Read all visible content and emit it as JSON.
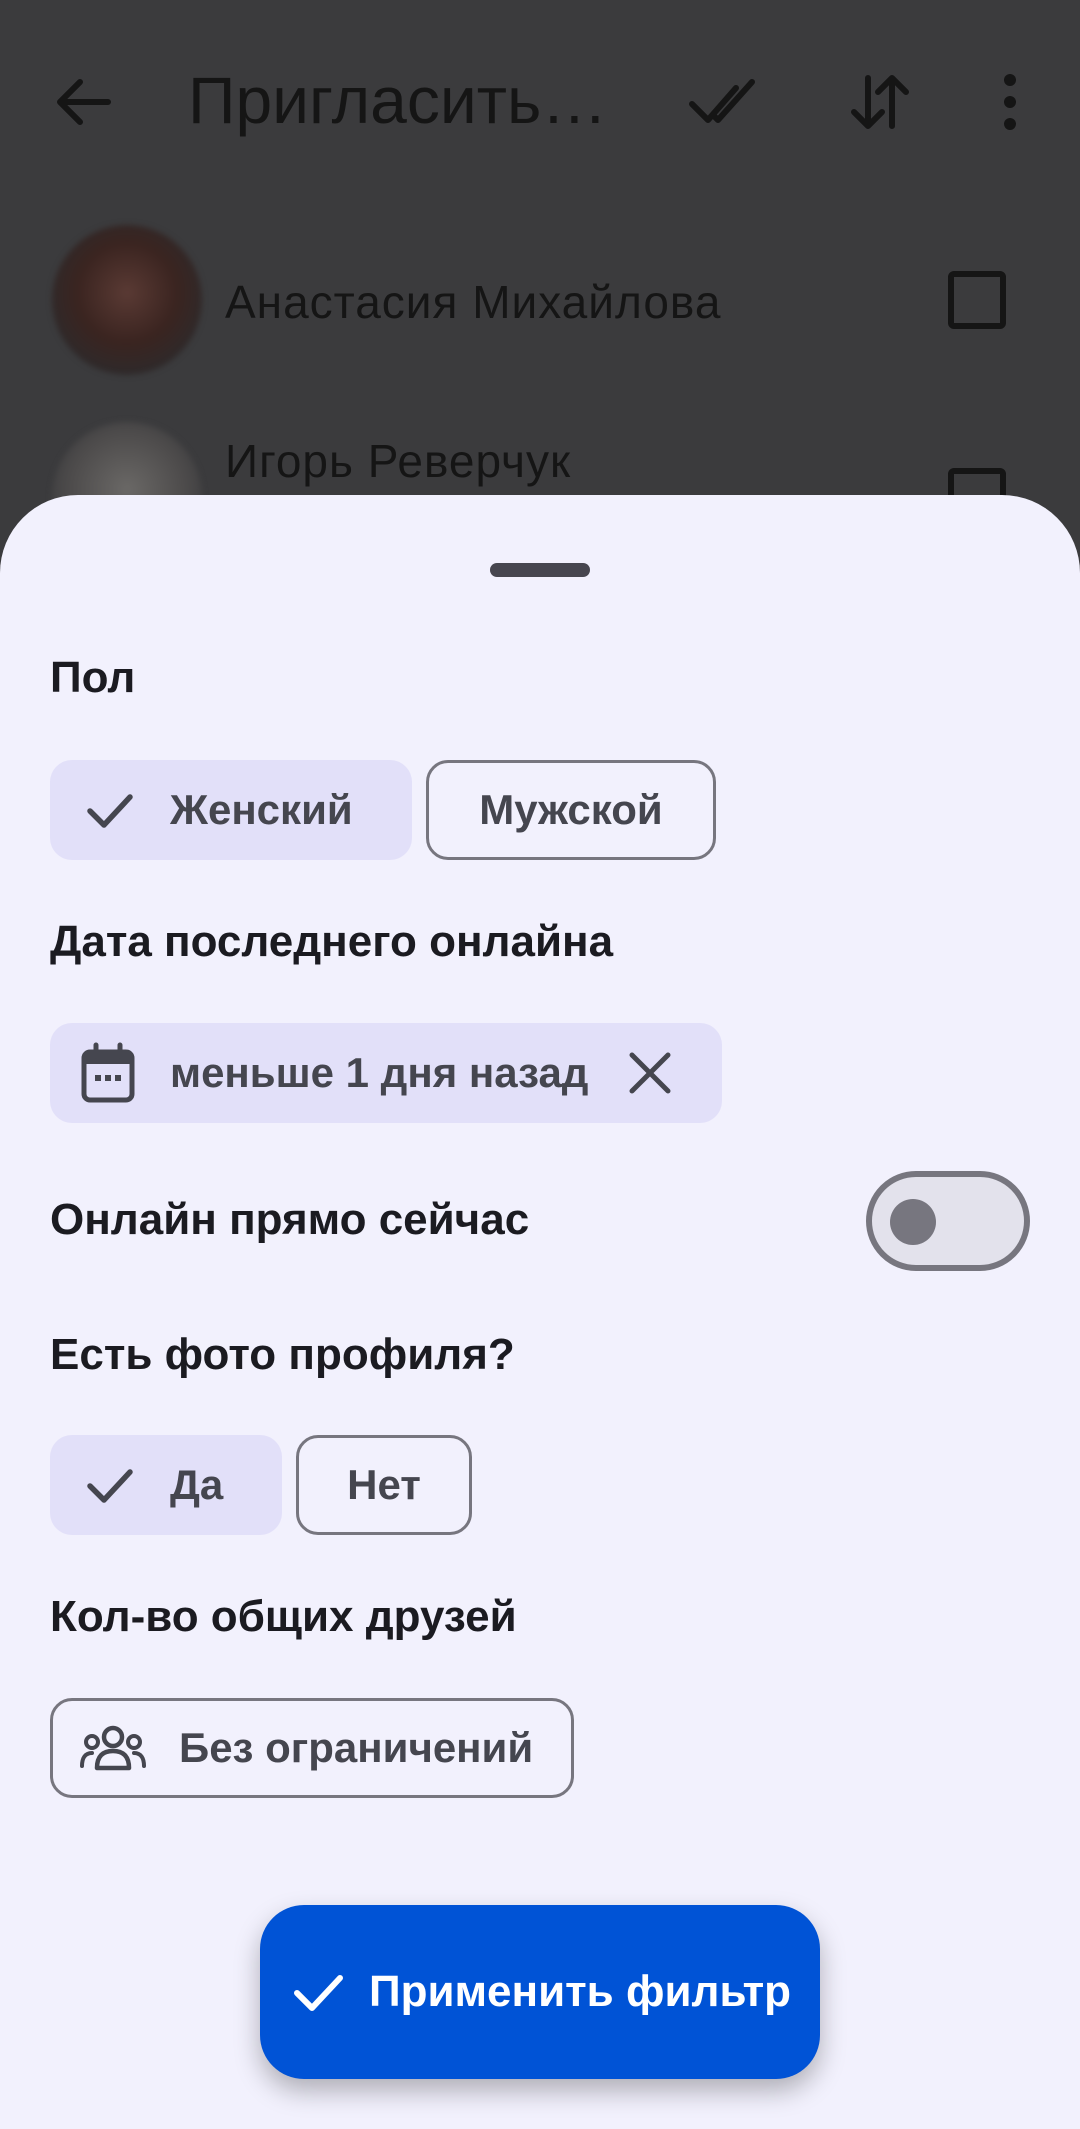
{
  "app_bar": {
    "title": "Пригласить…",
    "back_icon": "arrow-back-icon",
    "select_all_icon": "double-check-icon",
    "sort_icon": "sort-icon",
    "menu_icon": "more-vert-icon"
  },
  "contacts": [
    {
      "name": "Анастасия Михайлова"
    },
    {
      "name": "Игорь Реверчук"
    }
  ],
  "filter": {
    "gender": {
      "title": "Пол",
      "options": [
        {
          "label": "Женский",
          "selected": true
        },
        {
          "label": "Мужской",
          "selected": false
        }
      ]
    },
    "last_online": {
      "title": "Дата последнего онлайна",
      "chip_label": "меньше 1 дня назад",
      "icon": "calendar-icon",
      "clear_icon": "close-icon"
    },
    "online_now": {
      "title": "Онлайн прямо сейчас",
      "enabled": false
    },
    "has_photo": {
      "title": "Есть фото профиля?",
      "options": [
        {
          "label": "Да",
          "selected": true
        },
        {
          "label": "Нет",
          "selected": false
        }
      ]
    },
    "mutual_friends": {
      "title": "Кол-во общих друзей",
      "chip_label": "Без ограничений",
      "icon": "group-icon"
    },
    "apply_button": "Применить фильтр"
  },
  "colors": {
    "accent": "#0053d6",
    "selected_chip": "#e2e0f9",
    "sheet_background": "#f2f1fd",
    "scrim": "#3b3b3d"
  }
}
